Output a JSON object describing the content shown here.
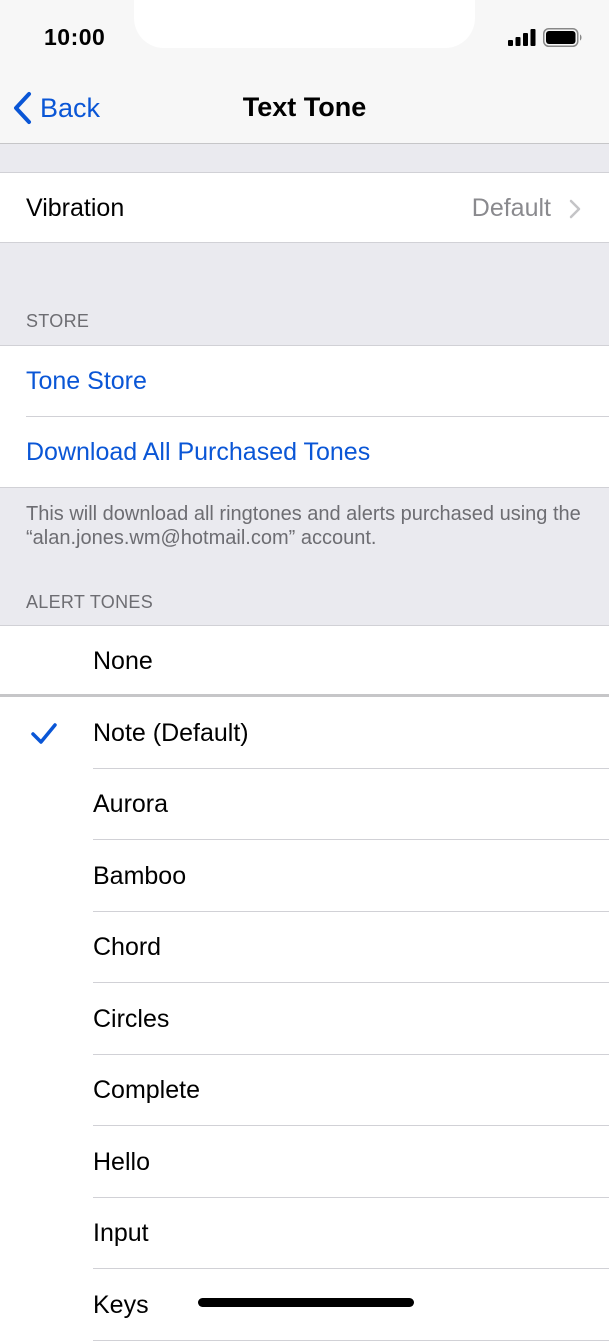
{
  "status_bar": {
    "time": "10:00"
  },
  "nav": {
    "back_label": "Back",
    "title": "Text Tone"
  },
  "vibration": {
    "label": "Vibration",
    "value": "Default"
  },
  "store": {
    "header": "STORE",
    "tone_store_label": "Tone Store",
    "download_label": "Download All Purchased Tones",
    "footer": "This will download all ringtones and alerts purchased using the “alan.jones.wm@hotmail.com” account."
  },
  "alert_tones": {
    "header": "ALERT TONES",
    "items": [
      {
        "label": "None",
        "selected": false
      },
      {
        "label": "Note (Default)",
        "selected": true
      },
      {
        "label": "Aurora",
        "selected": false
      },
      {
        "label": "Bamboo",
        "selected": false
      },
      {
        "label": "Chord",
        "selected": false
      },
      {
        "label": "Circles",
        "selected": false
      },
      {
        "label": "Complete",
        "selected": false
      },
      {
        "label": "Hello",
        "selected": false
      },
      {
        "label": "Input",
        "selected": false
      },
      {
        "label": "Keys",
        "selected": false
      }
    ]
  },
  "colors": {
    "accent": "#0a56d6",
    "grouped_background": "#eaeaef",
    "secondary_text": "#6d6d72"
  }
}
